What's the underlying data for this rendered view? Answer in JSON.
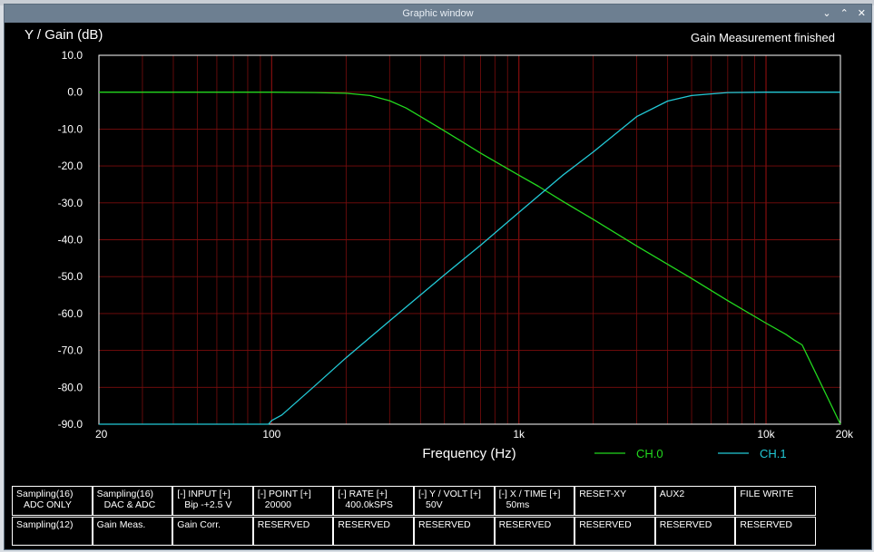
{
  "window": {
    "title": "Graphic window",
    "controls": [
      "⌄",
      "⌃",
      "✕"
    ]
  },
  "plot": {
    "ylabel": "Y / Gain (dB)",
    "xlabel": "Frequency (Hz)",
    "status": "Gain Measurement finished",
    "background": "#000000",
    "grid_color": "#7a0d0d",
    "axis_color": "#ffffff"
  },
  "chart_data": {
    "type": "line",
    "x_scale": "log",
    "xlim": [
      20,
      20000
    ],
    "ylim": [
      -90,
      10
    ],
    "y_ticks": [
      "10.0",
      "0.0",
      "-10.0",
      "-20.0",
      "-30.0",
      "-40.0",
      "-50.0",
      "-60.0",
      "-70.0",
      "-80.0",
      "-90.0"
    ],
    "x_ticks": [
      {
        "value": 20,
        "label": "20"
      },
      {
        "value": 100,
        "label": "100"
      },
      {
        "value": 1000,
        "label": "1k"
      },
      {
        "value": 10000,
        "label": "10k"
      },
      {
        "value": 20000,
        "label": "20k"
      }
    ],
    "grid": true,
    "legend_placement": "bottom-right",
    "series": [
      {
        "name": "CH.0",
        "color": "#22d81e",
        "x": [
          20,
          50,
          100,
          150,
          200,
          250,
          300,
          350,
          400,
          500,
          700,
          1000,
          1200,
          1500,
          2000,
          3000,
          5000,
          7000,
          10000,
          12000,
          13000,
          14000,
          20000
        ],
        "y": [
          0,
          0,
          0,
          -0.1,
          -0.3,
          -0.9,
          -2.3,
          -4.3,
          -6.6,
          -10.5,
          -16.5,
          -22.5,
          -25.5,
          -29.5,
          -34.5,
          -41.7,
          -50.5,
          -56.5,
          -62.6,
          -65.6,
          -67.2,
          -68.5,
          -90
        ]
      },
      {
        "name": "CH.1",
        "color": "#22c9d6",
        "x": [
          20,
          97,
          100,
          110,
          150,
          200,
          300,
          500,
          700,
          1000,
          1500,
          2000,
          3000,
          4000,
          5000,
          7000,
          10000,
          20000
        ],
        "y": [
          -90,
          -90,
          -89,
          -87.5,
          -79.5,
          -72,
          -62,
          -49.5,
          -41.5,
          -32.6,
          -22.6,
          -16.2,
          -6.6,
          -2.4,
          -0.9,
          -0.1,
          0,
          0
        ]
      }
    ]
  },
  "controls": [
    {
      "l1": "Sampling(16)",
      "l2": "ADC ONLY"
    },
    {
      "l1": "Sampling(16)",
      "l2": "DAC & ADC"
    },
    {
      "l1": "[-]  INPUT  [+]",
      "l2": "Bip -+2.5 V"
    },
    {
      "l1": "[-]  POINT  [+]",
      "l2": "20000"
    },
    {
      "l1": "[-]   RATE    [+]",
      "l2": "400.0kSPS"
    },
    {
      "l1": "[-]  Y / VOLT [+]",
      "l2": "50V"
    },
    {
      "l1": "[-]  X / TIME [+]",
      "l2": "50ms"
    },
    {
      "l1": "RESET-XY",
      "l2": ""
    },
    {
      "l1": "AUX2",
      "l2": ""
    },
    {
      "l1": "FILE WRITE",
      "l2": ""
    },
    {
      "l1": "Sampling(12)",
      "l2": ""
    },
    {
      "l1": "Gain Meas.",
      "l2": ""
    },
    {
      "l1": "Gain Corr.",
      "l2": ""
    },
    {
      "l1": "RESERVED",
      "l2": ""
    },
    {
      "l1": "RESERVED",
      "l2": ""
    },
    {
      "l1": "RESERVED",
      "l2": ""
    },
    {
      "l1": "RESERVED",
      "l2": ""
    },
    {
      "l1": "RESERVED",
      "l2": ""
    },
    {
      "l1": "RESERVED",
      "l2": ""
    },
    {
      "l1": "RESERVED",
      "l2": ""
    }
  ]
}
